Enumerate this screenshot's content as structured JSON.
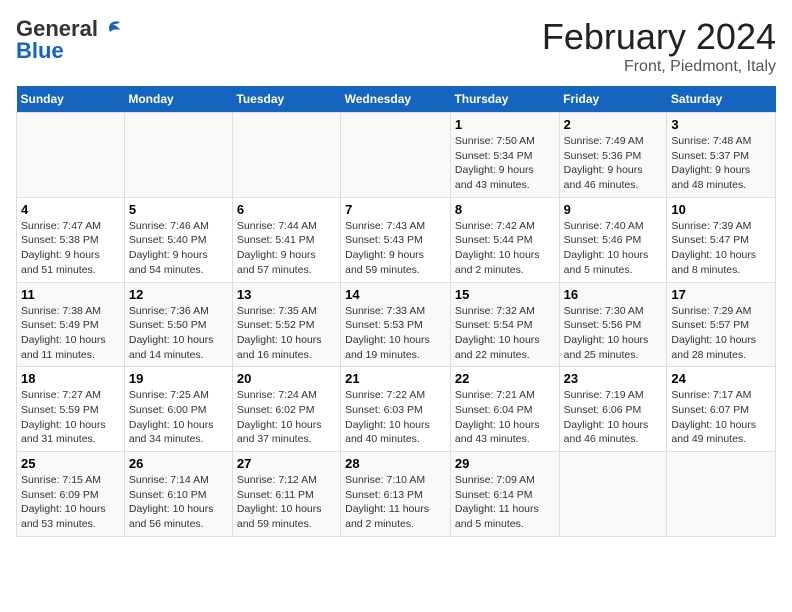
{
  "logo": {
    "line1": "General",
    "line2": "Blue"
  },
  "title": "February 2024",
  "subtitle": "Front, Piedmont, Italy",
  "days_of_week": [
    "Sunday",
    "Monday",
    "Tuesday",
    "Wednesday",
    "Thursday",
    "Friday",
    "Saturday"
  ],
  "weeks": [
    [
      {
        "num": "",
        "info": ""
      },
      {
        "num": "",
        "info": ""
      },
      {
        "num": "",
        "info": ""
      },
      {
        "num": "",
        "info": ""
      },
      {
        "num": "1",
        "info": "Sunrise: 7:50 AM\nSunset: 5:34 PM\nDaylight: 9 hours\nand 43 minutes."
      },
      {
        "num": "2",
        "info": "Sunrise: 7:49 AM\nSunset: 5:36 PM\nDaylight: 9 hours\nand 46 minutes."
      },
      {
        "num": "3",
        "info": "Sunrise: 7:48 AM\nSunset: 5:37 PM\nDaylight: 9 hours\nand 48 minutes."
      }
    ],
    [
      {
        "num": "4",
        "info": "Sunrise: 7:47 AM\nSunset: 5:38 PM\nDaylight: 9 hours\nand 51 minutes."
      },
      {
        "num": "5",
        "info": "Sunrise: 7:46 AM\nSunset: 5:40 PM\nDaylight: 9 hours\nand 54 minutes."
      },
      {
        "num": "6",
        "info": "Sunrise: 7:44 AM\nSunset: 5:41 PM\nDaylight: 9 hours\nand 57 minutes."
      },
      {
        "num": "7",
        "info": "Sunrise: 7:43 AM\nSunset: 5:43 PM\nDaylight: 9 hours\nand 59 minutes."
      },
      {
        "num": "8",
        "info": "Sunrise: 7:42 AM\nSunset: 5:44 PM\nDaylight: 10 hours\nand 2 minutes."
      },
      {
        "num": "9",
        "info": "Sunrise: 7:40 AM\nSunset: 5:46 PM\nDaylight: 10 hours\nand 5 minutes."
      },
      {
        "num": "10",
        "info": "Sunrise: 7:39 AM\nSunset: 5:47 PM\nDaylight: 10 hours\nand 8 minutes."
      }
    ],
    [
      {
        "num": "11",
        "info": "Sunrise: 7:38 AM\nSunset: 5:49 PM\nDaylight: 10 hours\nand 11 minutes."
      },
      {
        "num": "12",
        "info": "Sunrise: 7:36 AM\nSunset: 5:50 PM\nDaylight: 10 hours\nand 14 minutes."
      },
      {
        "num": "13",
        "info": "Sunrise: 7:35 AM\nSunset: 5:52 PM\nDaylight: 10 hours\nand 16 minutes."
      },
      {
        "num": "14",
        "info": "Sunrise: 7:33 AM\nSunset: 5:53 PM\nDaylight: 10 hours\nand 19 minutes."
      },
      {
        "num": "15",
        "info": "Sunrise: 7:32 AM\nSunset: 5:54 PM\nDaylight: 10 hours\nand 22 minutes."
      },
      {
        "num": "16",
        "info": "Sunrise: 7:30 AM\nSunset: 5:56 PM\nDaylight: 10 hours\nand 25 minutes."
      },
      {
        "num": "17",
        "info": "Sunrise: 7:29 AM\nSunset: 5:57 PM\nDaylight: 10 hours\nand 28 minutes."
      }
    ],
    [
      {
        "num": "18",
        "info": "Sunrise: 7:27 AM\nSunset: 5:59 PM\nDaylight: 10 hours\nand 31 minutes."
      },
      {
        "num": "19",
        "info": "Sunrise: 7:25 AM\nSunset: 6:00 PM\nDaylight: 10 hours\nand 34 minutes."
      },
      {
        "num": "20",
        "info": "Sunrise: 7:24 AM\nSunset: 6:02 PM\nDaylight: 10 hours\nand 37 minutes."
      },
      {
        "num": "21",
        "info": "Sunrise: 7:22 AM\nSunset: 6:03 PM\nDaylight: 10 hours\nand 40 minutes."
      },
      {
        "num": "22",
        "info": "Sunrise: 7:21 AM\nSunset: 6:04 PM\nDaylight: 10 hours\nand 43 minutes."
      },
      {
        "num": "23",
        "info": "Sunrise: 7:19 AM\nSunset: 6:06 PM\nDaylight: 10 hours\nand 46 minutes."
      },
      {
        "num": "24",
        "info": "Sunrise: 7:17 AM\nSunset: 6:07 PM\nDaylight: 10 hours\nand 49 minutes."
      }
    ],
    [
      {
        "num": "25",
        "info": "Sunrise: 7:15 AM\nSunset: 6:09 PM\nDaylight: 10 hours\nand 53 minutes."
      },
      {
        "num": "26",
        "info": "Sunrise: 7:14 AM\nSunset: 6:10 PM\nDaylight: 10 hours\nand 56 minutes."
      },
      {
        "num": "27",
        "info": "Sunrise: 7:12 AM\nSunset: 6:11 PM\nDaylight: 10 hours\nand 59 minutes."
      },
      {
        "num": "28",
        "info": "Sunrise: 7:10 AM\nSunset: 6:13 PM\nDaylight: 11 hours\nand 2 minutes."
      },
      {
        "num": "29",
        "info": "Sunrise: 7:09 AM\nSunset: 6:14 PM\nDaylight: 11 hours\nand 5 minutes."
      },
      {
        "num": "",
        "info": ""
      },
      {
        "num": "",
        "info": ""
      }
    ]
  ]
}
